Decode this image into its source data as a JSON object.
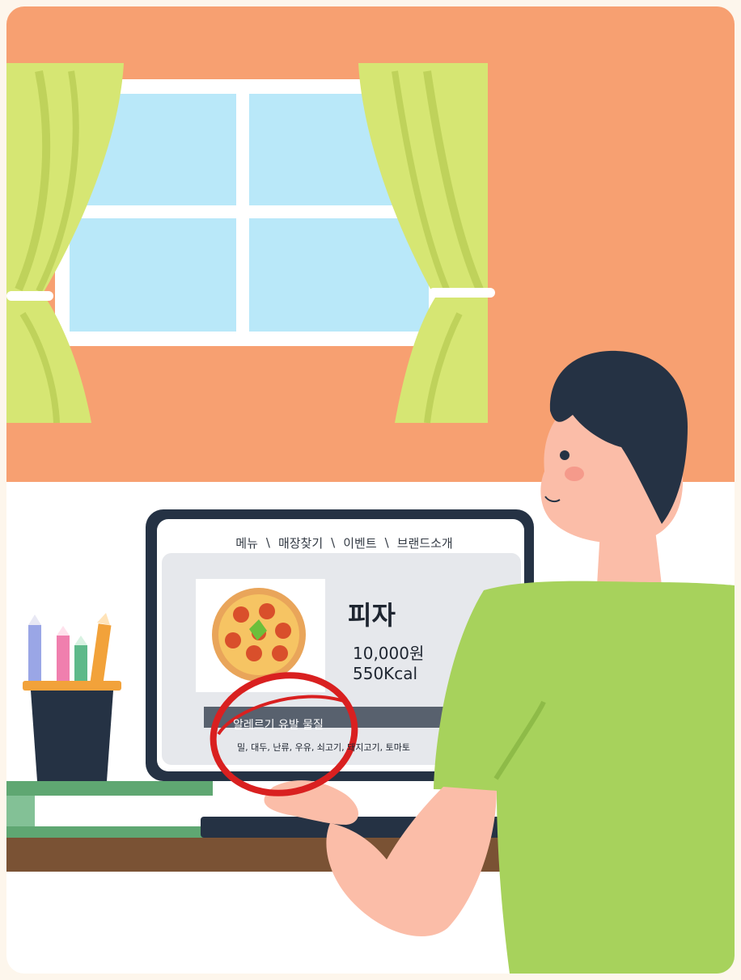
{
  "screen": {
    "nav_items": [
      "메뉴",
      "매장찾기",
      "이벤트",
      "브랜드소개"
    ],
    "nav_separator": "\\",
    "product": {
      "name": "피자",
      "price": "10,000원",
      "calories": "550Kcal",
      "allergy_heading": "알레르기 유발 물질",
      "allergy_list": "밀, 대두, 난류, 우유, 쇠고기, 돼지고기, 토마토"
    }
  },
  "colors": {
    "wall": "#f7a071",
    "window_glass": "#b9e8f9",
    "curtain": "#d6e673",
    "shirt": "#a7d25c",
    "hair": "#253244",
    "skin": "#fbbda8",
    "desk": "#7a5234",
    "highlight_circle": "#d92020"
  }
}
